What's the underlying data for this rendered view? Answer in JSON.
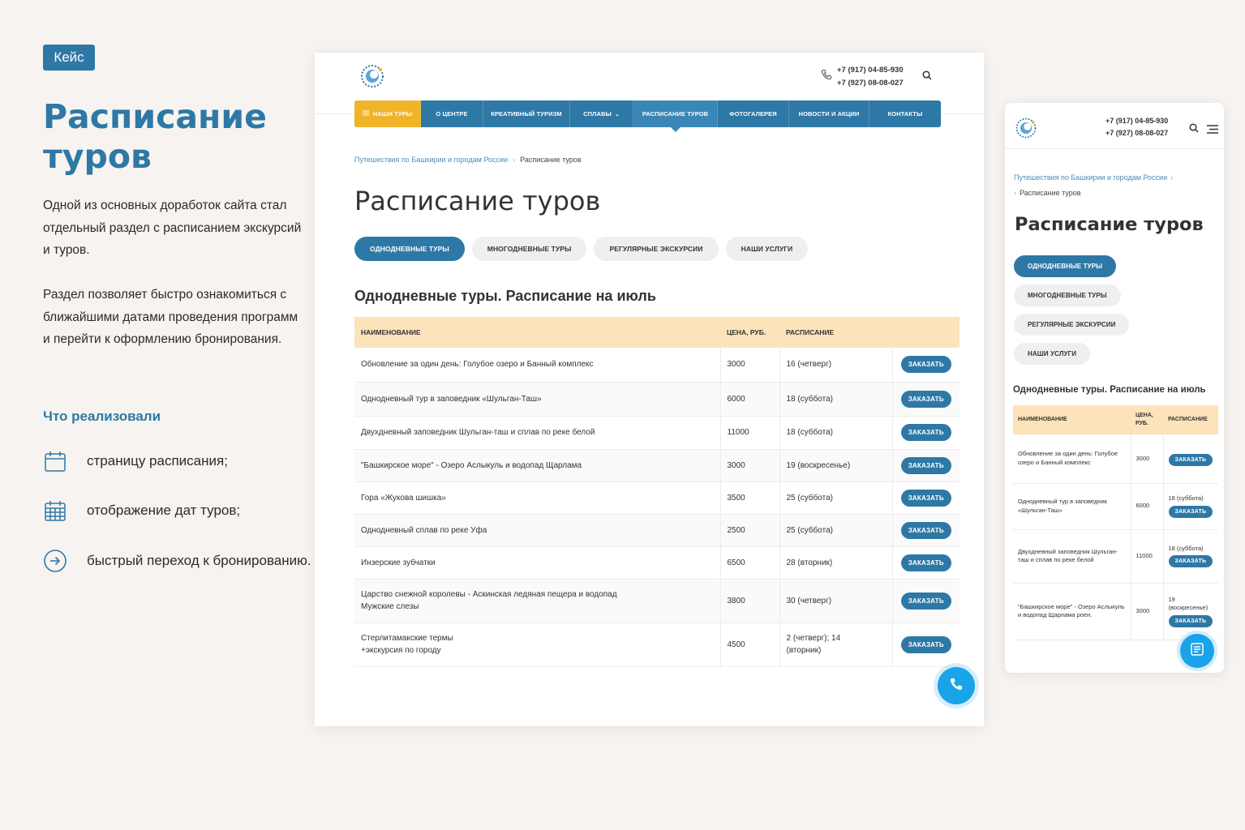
{
  "case": {
    "badge": "Кейс",
    "title": "Расписание туров",
    "paragraph1": "Одной из основных доработок сайта стал отдельный раздел с расписанием экскурсий и туров.",
    "paragraph2": "Раздел позволяет быстро ознакомиться с ближайшими датами проведения программ и перейти к оформлению бронирования.",
    "subtitle": "Что реализовали",
    "features": [
      {
        "icon": "calendar-icon",
        "label": "страницу расписания;"
      },
      {
        "icon": "calendar-grid-icon",
        "label": "отображение дат туров;"
      },
      {
        "icon": "arrow-right-circle-icon",
        "label": "быстрый переход к бронированию."
      }
    ]
  },
  "colors": {
    "accent": "#2e78a6",
    "menu_yellow": "#f0b429",
    "table_header": "#fde3ba",
    "call_button": "#1aa3e8"
  },
  "site": {
    "phones": [
      "+7 (917) 04-85-930",
      "+7 (927) 08-08-027"
    ],
    "nav": [
      "НАШИ ТУРЫ",
      "О ЦЕНТРЕ",
      "КРЕАТИВНЫЙ ТУРИЗМ",
      "СПЛАВЫ",
      "РАСПИСАНИЕ ТУРОВ",
      "ФОТОГАЛЕРЕЯ",
      "НОВОСТИ И АКЦИИ",
      "КОНТАКТЫ"
    ],
    "breadcrumb": {
      "parent": "Путешествия по Башкирии и городам России",
      "current": "Расписание туров"
    },
    "page_title": "Расписание туров",
    "tabs": [
      "ОДНОДНЕВНЫЕ ТУРЫ",
      "МНОГОДНЕВНЫЕ ТУРЫ",
      "РЕГУЛЯРНЫЕ ЭКСКУРСИИ",
      "НАШИ УСЛУГИ"
    ],
    "section_title": "Однодневные туры. Расписание на июль",
    "table": {
      "headers": {
        "name": "НАИМЕНОВАНИЕ",
        "price": "ЦЕНА, РУБ.",
        "schedule": "РАСПИСАНИЕ"
      },
      "order_label": "ЗАКАЗАТЬ",
      "rows": [
        {
          "name": "Обновление за один день: Голубое озеро и Банный комплекс",
          "price": "3000",
          "schedule": "16 (четверг)"
        },
        {
          "name": "Однодневный тур в заповедник «Шульган-Таш»",
          "price": "6000",
          "schedule": "18 (суббота)"
        },
        {
          "name": "Двухдневный заповедник Шульган-таш и сплав по реке белой",
          "price": "11000",
          "schedule": "18 (суббота)"
        },
        {
          "name": "\"Башкирское море\" - Озеро Аслыкуль и водопад Щарлама",
          "price": "3000",
          "schedule": "19 (воскресенье)"
        },
        {
          "name": "Гора «Жукова шишка»",
          "price": "3500",
          "schedule": "25 (суббота)"
        },
        {
          "name": "Однодневный сплав по реке Уфа",
          "price": "2500",
          "schedule": "25 (суббота)"
        },
        {
          "name": "Инзерские зубчатки",
          "price": "6500",
          "schedule": "28 (вторник)"
        },
        {
          "name": "Царство снежной королевы - Аскинская ледяная пещера и водопад Мужские слезы",
          "price": "3800",
          "schedule": "30 (четверг)"
        },
        {
          "name": "Стерлитамакские термы +экскурсия по городу",
          "price": "4500",
          "schedule": "2 (четверг); 14 (вторник)"
        }
      ]
    }
  },
  "mobile": {
    "phones": [
      "+7 (917) 04-85-930",
      "+7 (927) 08-08-027"
    ],
    "breadcrumb": {
      "parent": "Путешествия по Башкирии и городам России",
      "current": "Расписание туров"
    },
    "page_title": "Расписание туров",
    "tabs": [
      "ОДНОДНЕВНЫЕ ТУРЫ",
      "МНОГОДНЕВНЫЕ ТУРЫ",
      "РЕГУЛЯРНЫЕ ЭКСКУРСИИ",
      "НАШИ УСЛУГИ"
    ],
    "section_title": "Однодневные туры. Расписание на июль",
    "table": {
      "headers": {
        "name": "НАИМЕНОВАНИЕ",
        "price": "ЦЕНА, РУБ.",
        "schedule": "РАСПИСАНИЕ"
      },
      "order_label": "ЗАКАЗАТЬ",
      "rows": [
        {
          "name": "Обновление за один день: Голубое озеро и Банный комплекс",
          "price": "3000",
          "schedule": ""
        },
        {
          "name": "Однодневный тур в заповедник «Шульган-Таш»",
          "price": "6000",
          "schedule": "18 (суббота)"
        },
        {
          "name": "Двухдневный заповедник Шульган-таш и сплав по реке белой",
          "price": "11000",
          "schedule": "18 (суббота)"
        },
        {
          "name": "\"Башкирское море\" - Озеро Аслыкуль и водопад Щарлама роен.",
          "price": "3000",
          "schedule": "19 (воскресенье)"
        }
      ]
    }
  }
}
